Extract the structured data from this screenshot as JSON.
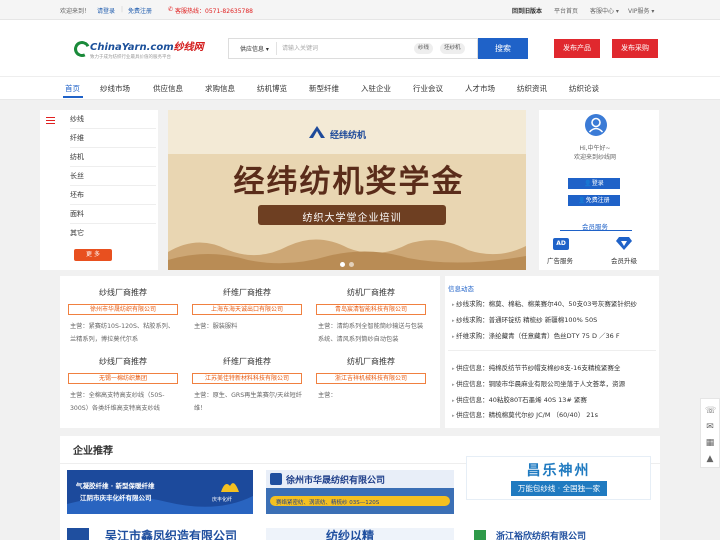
{
  "topbar": {
    "welcome": "欢迎来到！",
    "login": "请登录",
    "sep": "|",
    "register": "免费注册",
    "hotline": "客服热线：0571-82635788",
    "links": [
      "回到旧版本",
      "平台首页",
      "客服中心 ▾",
      "VIP服务 ▾"
    ]
  },
  "header": {
    "logo_text": "ChinaYarn.com",
    "logo_cn": "纱线网",
    "slogan": "致力于成为纺织行业最具价值的服务平台",
    "search_category": "供应信息 ▾",
    "search_placeholder": "请输入关键词",
    "search_chips": [
      "纱线",
      "坯纱机"
    ],
    "search_button": "搜索",
    "publish_product": "发布产品",
    "publish_purchase": "发布采购"
  },
  "nav": {
    "items": [
      "首页",
      "纱线市场",
      "供应信息",
      "求购信息",
      "纺机博览",
      "新型纤维",
      "入驻企业",
      "行业会议",
      "人才市场",
      "纺织资讯",
      "纺织论谈"
    ]
  },
  "categories": {
    "items": [
      "纱线",
      "纤维",
      "纺机",
      "长丝",
      "坯布",
      "面料",
      "其它"
    ],
    "more": "更 多"
  },
  "banner": {
    "brand": "经纬纺机",
    "title": "经纬纺机奖学金",
    "subtitle": "纺织大学堂企业培训"
  },
  "user": {
    "hello": "Hi,中午好~",
    "welcome": "欢迎来到纱线网",
    "login_button": "登录",
    "register_button": "免费注册",
    "member_service": "会员服务",
    "ad_service": "广告服务",
    "member_upgrade": "会员升级"
  },
  "recommend": {
    "row1": [
      {
        "title": "纱线厂商推荐",
        "company": "徐州市华晟纺织有限公司",
        "label": "主营：",
        "body": "紧赛纺10S-120S、粘胶系列、兰精系列，博拉莫代尔系"
      },
      {
        "title": "纤维厂商推荐",
        "company": "上海东海天诚出口有限公司",
        "label": "主营：",
        "body": "服装服料"
      },
      {
        "title": "纺机厂商推荐",
        "company": "青岛宸清智能科技有限公司",
        "label": "主营：",
        "body": "清韵系列全智能筒纱输送与包装系统、清风系列筒纱自动包装"
      }
    ],
    "row2": [
      {
        "title": "纱线厂商推荐",
        "company": "无锡一棉纺织集团",
        "label": "主营：",
        "body": "全棉高支特高支纱线（50S-300S）各类纤维高支特高支纱线"
      },
      {
        "title": "纤维厂商推荐",
        "company": "江苏美佳特新材料科技有限公司",
        "label": "主营：",
        "body": "原生、GRS再生莱赛尔/天丝短纤维！"
      },
      {
        "title": "纺机厂商推荐",
        "company": "浙江吉祥机械科技有限公司",
        "label": "主营：",
        "body": ""
      }
    ]
  },
  "info": {
    "title": "信息动态",
    "purchase": [
      "纱线求购：棉莫、棉粘、棉莱赛尔40、50支03号灰赛紧针织纱",
      "纱线求购：普通环锭纺 精梳纱 新疆棉100% 50S",
      "纤维求购：涤纶藏青（任意藏青）色丝DTY 75 D ／36 F"
    ],
    "supply": [
      "供应信息：纯棉反纺节节纱帽支棉纱8支-16支精梳紧赛全",
      "供应信息：铜陵市华晨麻业有限公司坐落于人文荟萃，资源",
      "供应信息：40粘胶80T石墨烯 40S 13# 紧赛",
      "供应信息：精梳棉莫代尔纱 JC/M （60/40） 21s"
    ]
  },
  "enterprise": {
    "title": "企业推荐",
    "ads": [
      {
        "line1": "气凝胶纤维 · 新型保暖纤维",
        "line2": "江阴市庆丰化纤有限公司",
        "brand": "庆丰化纤"
      },
      {
        "line1": "徐州市华晟纺织有限公司",
        "line2": "赛络紧密纺、涡流纺、精梳纱 03S—120S"
      },
      {
        "line1": "昌乐神州",
        "line2": "万能包纱线 · 全国独一家"
      },
      {
        "line1": "吴江市鑫凤织造有限公司"
      },
      {
        "line1": "纺纱以精"
      },
      {
        "line1": "浙江裕欣纺织有限公司"
      }
    ]
  },
  "colors": {
    "primary": "#1f62c8",
    "accent_red": "#e0282e",
    "orange": "#e8501f"
  }
}
